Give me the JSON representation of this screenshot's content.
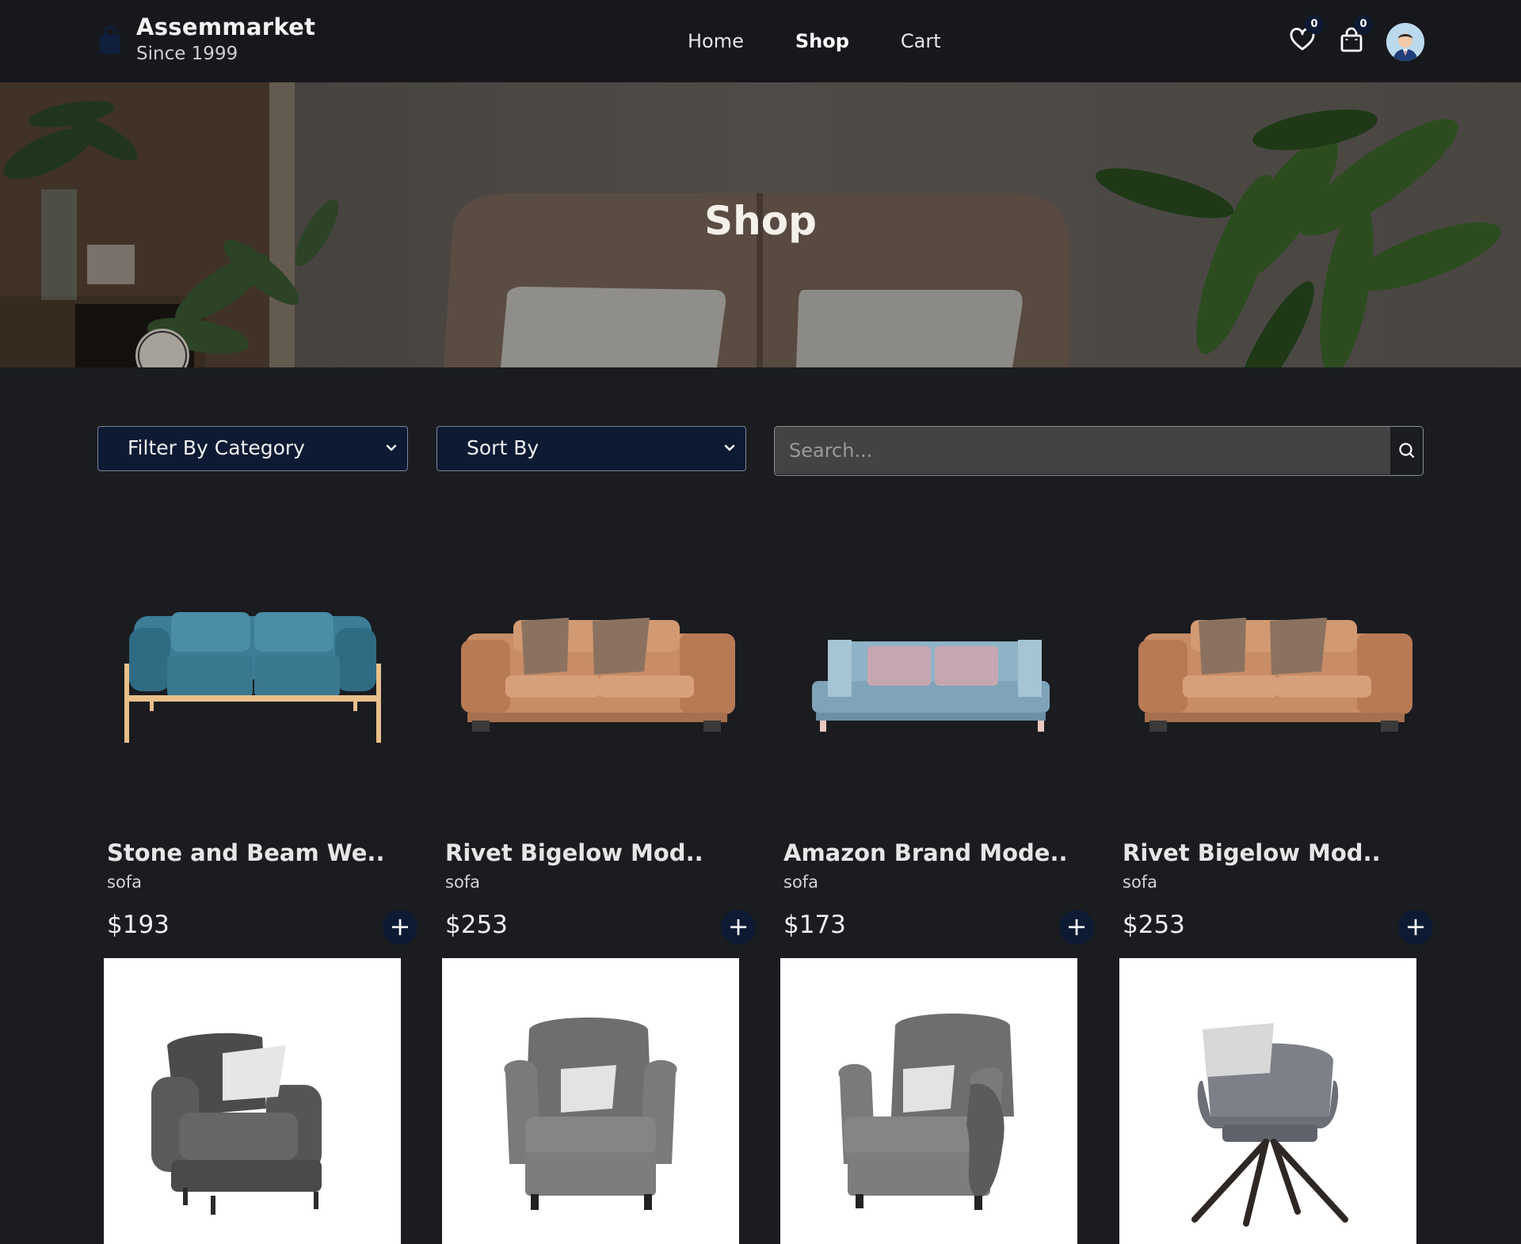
{
  "header": {
    "brand_name": "Assemmarket",
    "brand_tagline": "Since 1999",
    "nav": [
      {
        "label": "Home",
        "active": false
      },
      {
        "label": "Shop",
        "active": true
      },
      {
        "label": "Cart",
        "active": false
      }
    ],
    "wishlist_count": "0",
    "cart_count": "0",
    "icons": [
      "shopping-bag-icon",
      "heart-icon",
      "bag-icon",
      "avatar"
    ]
  },
  "hero": {
    "title": "Shop"
  },
  "filters": {
    "category_label": "Filter By Category",
    "sort_label": "Sort By",
    "search_placeholder": "Search..."
  },
  "products": [
    {
      "name": "Stone and Beam We..",
      "category": "sofa",
      "price": "$193",
      "color": "#3d7d96"
    },
    {
      "name": "Rivet Bigelow Mod..",
      "category": "sofa",
      "price": "$253",
      "color": "#c88d66"
    },
    {
      "name": "Amazon Brand Mode..",
      "category": "sofa",
      "price": "$173",
      "color": "#8fb2c6"
    },
    {
      "name": "Rivet Bigelow Mod..",
      "category": "sofa",
      "price": "$253",
      "color": "#c88d66"
    }
  ],
  "products_row2": [
    {
      "kind": "armchair"
    },
    {
      "kind": "wingback-chair"
    },
    {
      "kind": "wingback-chair-throw"
    },
    {
      "kind": "swivel-chair"
    }
  ],
  "colors": {
    "background": "#1a1c20",
    "header": "#17181c",
    "accent_navy": "#0d1a33"
  }
}
